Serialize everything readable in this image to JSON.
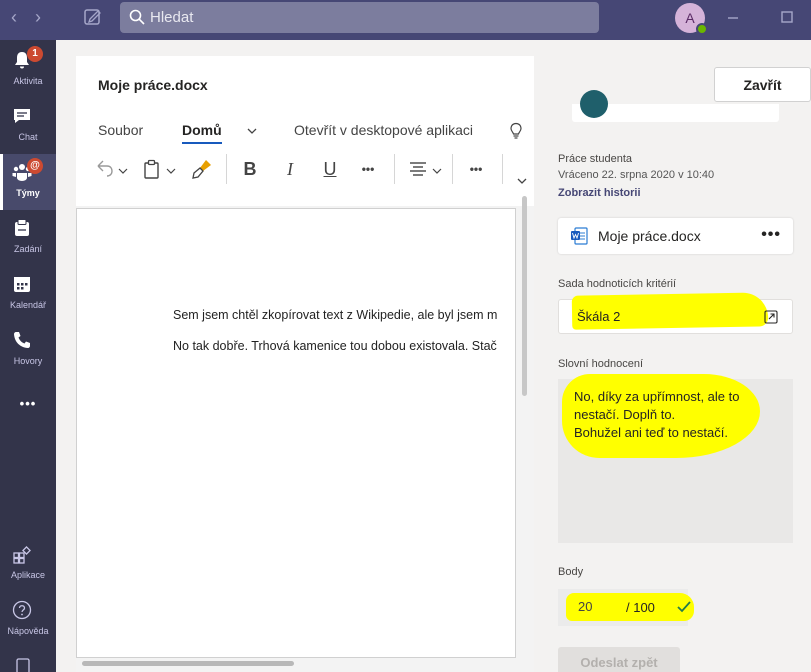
{
  "topbar": {
    "search_placeholder": "Hledat",
    "avatar_initial": "A",
    "back_glyph": "‹",
    "forward_glyph": "›"
  },
  "rail": {
    "items": [
      {
        "label": "Aktivita",
        "icon": "bell-icon",
        "badge": "1"
      },
      {
        "label": "Chat",
        "icon": "chat-icon"
      },
      {
        "label": "Týmy",
        "icon": "teams-icon",
        "badge": "@"
      },
      {
        "label": "Zadání",
        "icon": "assignments-icon"
      },
      {
        "label": "Kalendář",
        "icon": "calendar-icon"
      },
      {
        "label": "Hovory",
        "icon": "phone-icon"
      },
      {
        "label": "•••",
        "icon": "more-icon"
      },
      {
        "label": "Aplikace",
        "icon": "apps-icon"
      },
      {
        "label": "Nápověda",
        "icon": "help-icon"
      }
    ]
  },
  "doc": {
    "title": "Moje práce.docx",
    "tabs": [
      "Soubor",
      "Domů",
      "Otevřít v desktopové aplikaci"
    ],
    "tool_glyphs": {
      "bold": "B",
      "italic": "I",
      "underline": "U",
      "more": "•••"
    },
    "lines": [
      "Sem jsem chtěl zkopírovat text z Wikipedie, ale byl jsem m",
      "No tak dobře. Trhová kamenice tou dobou existovala. Stač"
    ]
  },
  "panel": {
    "close_label": "Zavřít",
    "student_work_label": "Práce studenta",
    "returned_text": "Vráceno 22. srpna 2020 v 10:40",
    "history_link": "Zobrazit historii",
    "file_name": "Moje práce.docx",
    "file_more": "•••",
    "rubric_label": "Sada hodnoticích kritérií",
    "rubric_name": "Škála 2",
    "feedback_label": "Slovní hodnocení",
    "feedback_text": "No, díky za upřímnost, ale to nestačí. Doplň to.\nBohužel ani teď to nestačí.",
    "points_label": "Body",
    "points_value": "20",
    "points_max": "/ 100",
    "send_label": "Odeslat zpět"
  },
  "colors": {
    "topbar": "#464775",
    "rail": "#33344a",
    "highlight": "#ffff00",
    "accent_link": "#464775",
    "word_blue": "#185abd"
  }
}
